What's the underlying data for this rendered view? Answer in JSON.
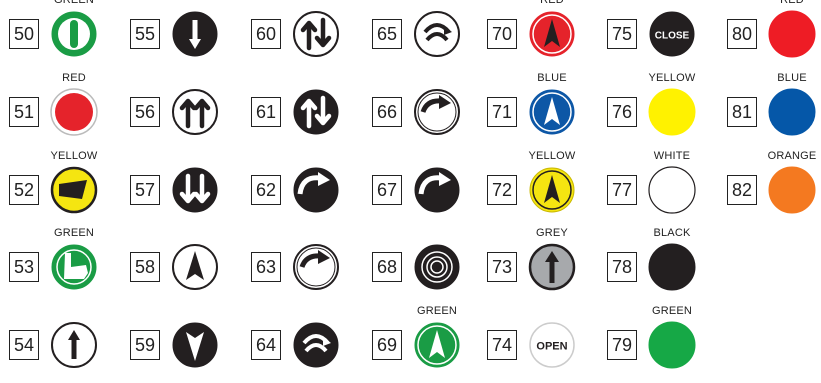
{
  "items": [
    {
      "number": "50",
      "label": "GREEN",
      "icon": "green-ring-bar-icon",
      "color": "#1a9c45"
    },
    {
      "number": "51",
      "label": "RED",
      "icon": "red-ringed-button-icon",
      "color": "#e5232b"
    },
    {
      "number": "52",
      "label": "YELLOW",
      "icon": "yellow-hand-icon",
      "color": "#f5e511"
    },
    {
      "number": "53",
      "label": "GREEN",
      "icon": "green-hand-icon",
      "color": "#1a9c45"
    },
    {
      "number": "54",
      "label": "",
      "icon": "up-arrow-icon",
      "color": "#222222"
    },
    {
      "number": "55",
      "label": "",
      "icon": "down-arrow-icon",
      "color": "#222222"
    },
    {
      "number": "56",
      "label": "",
      "icon": "double-up-arrow-icon",
      "color": "#222222"
    },
    {
      "number": "57",
      "label": "",
      "icon": "double-down-arrow-icon",
      "color": "#222222"
    },
    {
      "number": "58",
      "label": "",
      "icon": "triangle-up-icon",
      "color": "#222222"
    },
    {
      "number": "59",
      "label": "",
      "icon": "triangle-down-icon",
      "color": "#222222"
    },
    {
      "number": "60",
      "label": "",
      "icon": "up-down-arrows-icon",
      "color": "#222222"
    },
    {
      "number": "61",
      "label": "",
      "icon": "up-down-arrows-filled-icon",
      "color": "#222222"
    },
    {
      "number": "62",
      "label": "",
      "icon": "rotate-arrow-filled-icon",
      "color": "#222222"
    },
    {
      "number": "63",
      "label": "",
      "icon": "rotate-arrow-icon",
      "color": "#222222"
    },
    {
      "number": "64",
      "label": "",
      "icon": "double-rotate-arrow-filled-icon",
      "color": "#222222"
    },
    {
      "number": "65",
      "label": "",
      "icon": "double-rotate-arrow-icon",
      "color": "#222222"
    },
    {
      "number": "66",
      "label": "",
      "icon": "rotate-arrow-icon",
      "color": "#222222"
    },
    {
      "number": "67",
      "label": "",
      "icon": "rotate-arrow-filled-icon",
      "color": "#222222"
    },
    {
      "number": "68",
      "label": "",
      "icon": "concentric-rings-icon",
      "color": "#222222"
    },
    {
      "number": "69",
      "label": "GREEN",
      "icon": "green-triangle-up-icon",
      "color": "#1a9c45"
    },
    {
      "number": "70",
      "label": "RED",
      "icon": "red-triangle-up-icon",
      "color": "#e5232b"
    },
    {
      "number": "71",
      "label": "BLUE",
      "icon": "blue-triangle-up-icon",
      "color": "#0d57a6"
    },
    {
      "number": "72",
      "label": "YELLOW",
      "icon": "yellow-triangle-up-icon",
      "color": "#f5e511"
    },
    {
      "number": "73",
      "label": "GREY",
      "icon": "grey-up-arrow-icon",
      "color": "#a7a9ac"
    },
    {
      "number": "74",
      "label": "",
      "icon": "open-button-icon",
      "text": "OPEN",
      "color": "#ffffff"
    },
    {
      "number": "75",
      "label": "",
      "icon": "close-button-icon",
      "text": "CLOSE",
      "color": "#231f20"
    },
    {
      "number": "76",
      "label": "YELLOW",
      "icon": "yellow-circle-icon",
      "color": "#fff200"
    },
    {
      "number": "77",
      "label": "WHITE",
      "icon": "white-circle-icon",
      "color": "#ffffff"
    },
    {
      "number": "78",
      "label": "BLACK",
      "icon": "black-circle-icon",
      "color": "#231f20"
    },
    {
      "number": "79",
      "label": "GREEN",
      "icon": "green-circle-icon",
      "color": "#16a846"
    },
    {
      "number": "80",
      "label": "RED",
      "icon": "red-circle-icon",
      "color": "#ee1c25"
    },
    {
      "number": "81",
      "label": "BLUE",
      "icon": "blue-circle-icon",
      "color": "#0557a8"
    },
    {
      "number": "82",
      "label": "ORANGE",
      "icon": "orange-circle-icon",
      "color": "#f47920"
    }
  ]
}
